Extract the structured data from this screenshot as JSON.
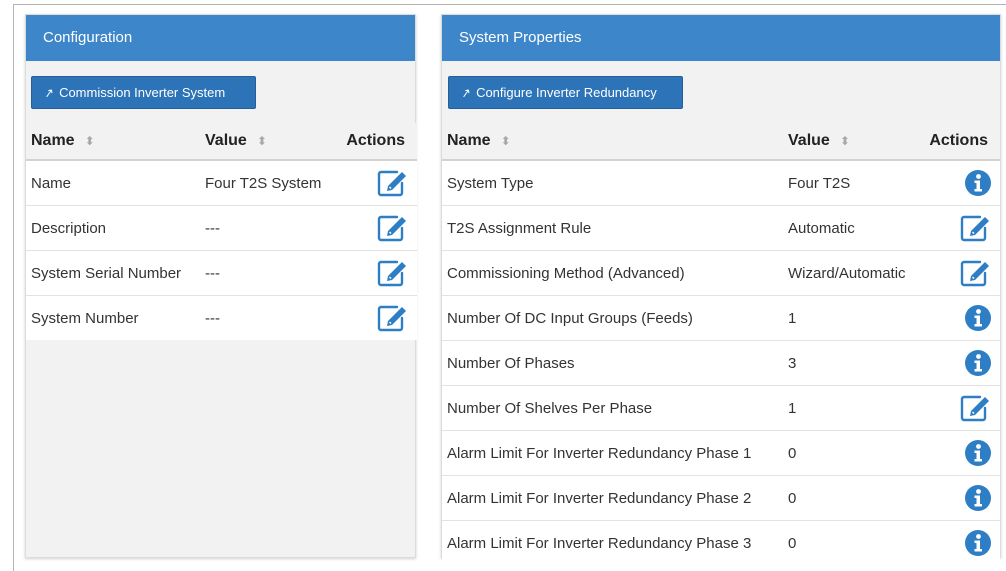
{
  "config": {
    "title": "Configuration",
    "button_label": "Commission Inverter System",
    "columns": {
      "name": "Name",
      "value": "Value",
      "actions": "Actions"
    },
    "rows": [
      {
        "name": "Name",
        "value": "Four T2S System",
        "action": "edit-icon"
      },
      {
        "name": "Description",
        "value": "---",
        "action": "edit-icon"
      },
      {
        "name": "System Serial Number",
        "value": "---",
        "action": "edit-icon"
      },
      {
        "name": "System Number",
        "value": "---",
        "action": "edit-icon"
      }
    ]
  },
  "props": {
    "title": "System Properties",
    "button_label": "Configure Inverter Redundancy",
    "columns": {
      "name": "Name",
      "value": "Value",
      "actions": "Actions"
    },
    "rows": [
      {
        "name": "System Type",
        "value": "Four T2S",
        "action": "info-icon"
      },
      {
        "name": "T2S Assignment Rule",
        "value": "Automatic",
        "action": "edit-icon"
      },
      {
        "name": "Commissioning Method (Advanced)",
        "value": "Wizard/Automatic",
        "action": "edit-icon"
      },
      {
        "name": "Number Of DC Input Groups (Feeds)",
        "value": "1",
        "action": "info-icon"
      },
      {
        "name": "Number Of Phases",
        "value": "3",
        "action": "info-icon"
      },
      {
        "name": "Number Of Shelves Per Phase",
        "value": "1",
        "action": "edit-icon"
      },
      {
        "name": "Alarm Limit For Inverter Redundancy Phase 1",
        "value": "0",
        "action": "info-icon"
      },
      {
        "name": "Alarm Limit For Inverter Redundancy Phase 2",
        "value": "0",
        "action": "info-icon"
      },
      {
        "name": "Alarm Limit For Inverter Redundancy Phase 3",
        "value": "0",
        "action": "info-icon"
      }
    ]
  },
  "colors": {
    "header": "#3d86c9",
    "button": "#2c73b8",
    "icon": "#2d7ec4"
  }
}
